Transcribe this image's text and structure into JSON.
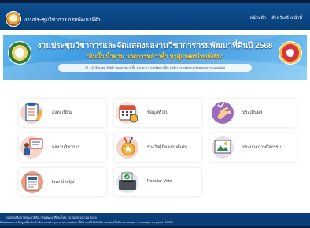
{
  "nav": {
    "title": "งานประชุมวิชาการ กรมพัฒนาที่ดิน",
    "links": [
      "หน้าหลัก",
      "สำหรับเจ้าหน้าที่"
    ]
  },
  "banner": {
    "title": "งานประชุมวิชาการและจัดแสดงผลงานวิชาการกรมพัฒนาที่ดินปี 2568",
    "subtitle": "\"ดินน้ำ น้ำตาม นวัตกรรมก้าวล้ำ นำสู่เกษตรไทยยั่งยืน\"",
    "dateline": "27 – 28 สิงหาคม 2568 | ห้องประชุม 6 ชั้น 1 อาคาร 1 กรมพัฒนาที่ดิน จตุจักร กรุงเทพฯ และรับชมผ่านระบบออนไลน์"
  },
  "cards": [
    {
      "label": "ลงทะเบียน",
      "icon": "registration-form-icon"
    },
    {
      "label": "ข้อมูลทั่วไป",
      "icon": "calendar-icon"
    },
    {
      "label": "ประเมินผล",
      "icon": "checkmark-hand-icon"
    },
    {
      "label": "ผลงานวิชาการ",
      "icon": "presentation-icon"
    },
    {
      "label": "รางวัลผู้มีผลงานดีเด่น",
      "icon": "award-medal-icon"
    },
    {
      "label": "ประมวลภาพกิจกรรม",
      "icon": "photo-gallery-icon"
    },
    {
      "label": "Live ประชุม",
      "icon": "live-news-icon"
    },
    {
      "label": "Popular Vote",
      "icon": "vote-box-icon"
    }
  ],
  "footer": {
    "line1": "กองส่งเสริมการพัฒนาที่ดิน กรมพัฒนาที่ดิน  โทร. 02 5625 100 ต่อ 3020",
    "line2": "ติดต่อสอบถามข้อมูลเพิ่มเติม สำนักงานเลขานุการกรม กรมพัฒนาที่ดิน เลขที่ 2003/61 ถนนพหลโยธิน แขวงลาดยาว เขตจตุจักร กรุงเทพฯ 10900"
  },
  "colors": {
    "nav_bg": "#0b4686",
    "banner_bg": "#3a97de",
    "subtitle": "#f6d33a",
    "footer_bg": "#0b3e78"
  }
}
